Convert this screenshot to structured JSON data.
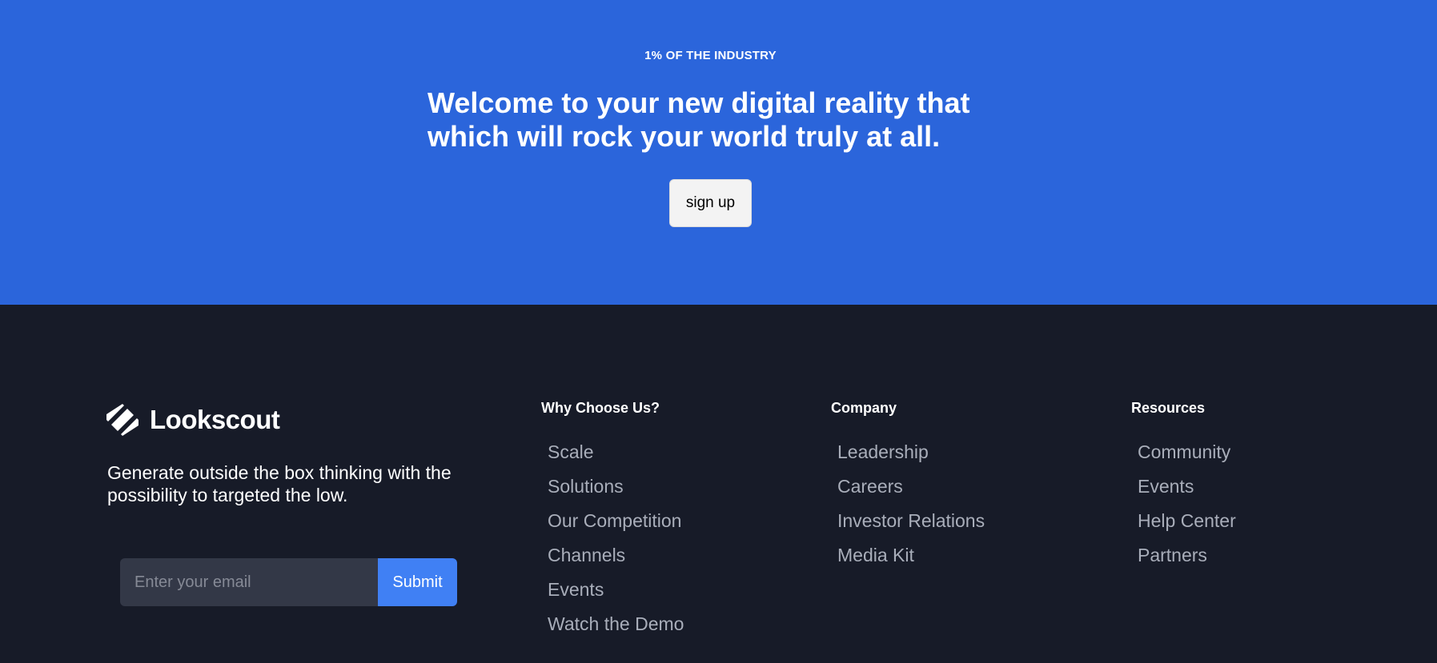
{
  "hero": {
    "eyebrow": "1% OF THE INDUSTRY",
    "headline_line1": "Welcome to your new digital reality that",
    "headline_line2": "which will rock your world truly at all.",
    "cta_label": "sign up",
    "background_color": "#2b65db"
  },
  "footer": {
    "background_color": "#171b28",
    "brand": {
      "name": "Lookscout",
      "logo_icon": "striped-diamond-logo"
    },
    "tagline": "Generate outside the box thinking with the possibility to targeted the low.",
    "newsletter": {
      "email_placeholder": "Enter your email",
      "submit_label": "Submit",
      "accent_color": "#4080f4"
    },
    "columns": {
      "why": {
        "heading": "Why Choose Us?",
        "links": [
          "Scale",
          "Solutions",
          "Our Competition",
          "Channels",
          "Events",
          "Watch the Demo"
        ]
      },
      "company": {
        "heading": "Company",
        "links": [
          "Leadership",
          "Careers",
          "Investor Relations",
          "Media Kit"
        ]
      },
      "resources": {
        "heading": "Resources",
        "links": [
          "Community",
          "Events",
          "Help Center",
          "Partners"
        ]
      }
    }
  }
}
